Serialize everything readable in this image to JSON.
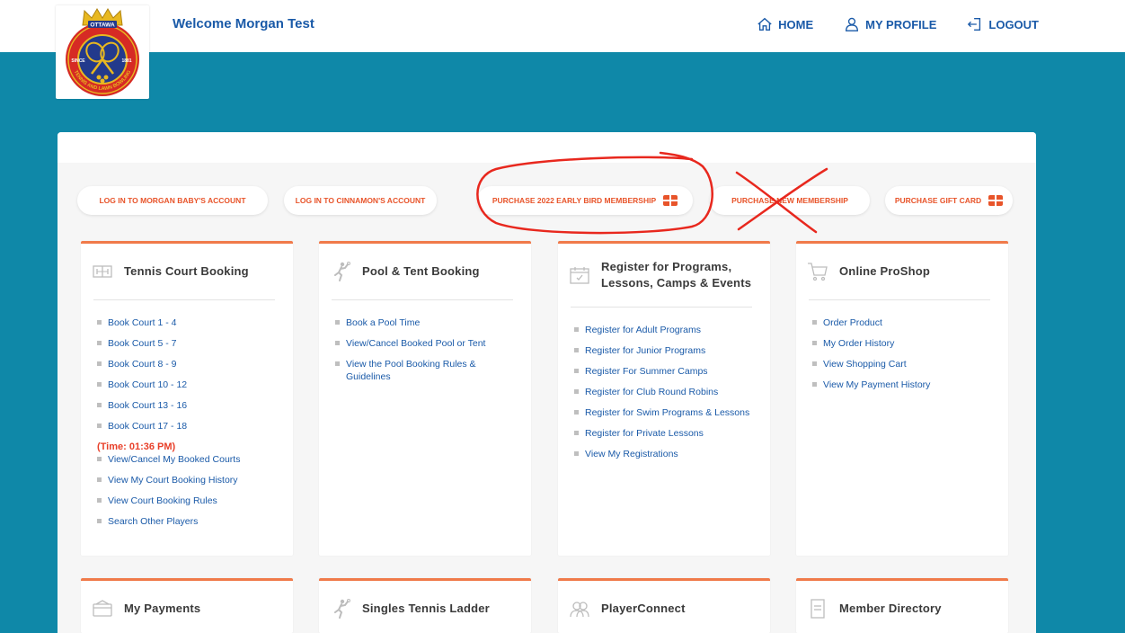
{
  "header": {
    "welcome": "Welcome Morgan Test",
    "nav": [
      {
        "label": "HOME",
        "icon": "home-icon"
      },
      {
        "label": "MY PROFILE",
        "icon": "profile-icon"
      },
      {
        "label": "LOGOUT",
        "icon": "logout-icon"
      }
    ]
  },
  "logo": {
    "top_text": "OTTAWA",
    "left_text": "SINCE",
    "right_text": "1881",
    "ring_text": "TENNIS AND LAWN BOWLING"
  },
  "actions": [
    {
      "label": "LOG IN TO MORGAN BABY'S ACCOUNT",
      "gift": false
    },
    {
      "label": "LOG IN TO CINNAMON'S ACCOUNT",
      "gift": false
    },
    {
      "label": "PURCHASE 2022 EARLY BIRD MEMBERSHIP",
      "gift": true
    },
    {
      "label": "PURCHASE NEW MEMBERSHIP",
      "gift": false
    },
    {
      "label": "PURCHASE GIFT CARD",
      "gift": true
    }
  ],
  "cards": {
    "tennis": {
      "title": "Tennis Court Booking",
      "icon": "tennis-court-icon",
      "links_a": [
        "Book Court 1 - 4",
        "Book Court 5 - 7",
        "Book Court 8 - 9",
        "Book Court 10 - 12",
        "Book Court 13 - 16",
        "Book Court 17 - 18"
      ],
      "time": "(Time: 01:36 PM)",
      "links_b": [
        "View/Cancel My Booked Courts",
        "View My Court Booking History",
        "View Court Booking Rules",
        "Search Other Players"
      ]
    },
    "pool": {
      "title": "Pool & Tent Booking",
      "icon": "player-icon",
      "links": [
        "Book a Pool Time",
        "View/Cancel Booked Pool or Tent",
        "View the Pool Booking Rules & Guidelines"
      ]
    },
    "programs": {
      "title_line1": "Register for Programs,",
      "title_line2": "Lessons, Camps & Events",
      "icon": "calendar-icon",
      "links": [
        "Register for Adult Programs",
        "Register for Junior Programs",
        "Register For Summer Camps",
        "Register for Club Round Robins",
        "Register for Swim Programs & Lessons",
        "Register for Private Lessons",
        "View My Registrations"
      ]
    },
    "proshop": {
      "title": "Online ProShop",
      "icon": "cart-icon",
      "links": [
        "Order Product",
        "My Order History",
        "View Shopping Cart",
        "View My Payment History"
      ]
    },
    "payments": {
      "title": "My Payments",
      "icon": "payments-icon"
    },
    "ladder": {
      "title": "Singles Tennis Ladder",
      "icon": "player-icon"
    },
    "playerconnect": {
      "title": "PlayerConnect",
      "icon": "players-icon"
    },
    "directory": {
      "title": "Member Directory",
      "icon": "directory-icon"
    }
  },
  "colors": {
    "band": "#0f88a8",
    "link": "#1a5aa8",
    "accent": "#e8542a",
    "card_border": "#f07a4a",
    "annotation": "#e8281e"
  }
}
